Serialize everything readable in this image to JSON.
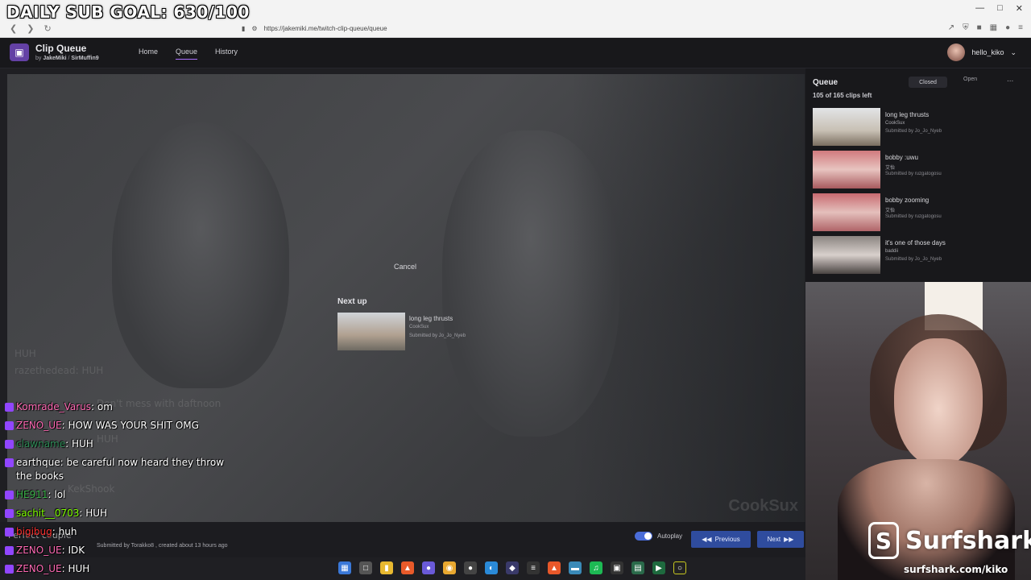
{
  "overlay": {
    "sub_goal": "DAILY SUB GOAL: 630/100"
  },
  "browser": {
    "url": "https://jakemiki.me/twitch-clip-queue/queue"
  },
  "header": {
    "title": "Clip Queue",
    "by_prefix": "by",
    "author1": "JakeMiki",
    "author_sep": "/",
    "author2": "SirMuffin9",
    "nav": [
      "Home",
      "Queue",
      "History"
    ],
    "username": "hello_kiko"
  },
  "player": {
    "cancel": "Cancel",
    "next_up_label": "Next up",
    "next_up_title": "long leg thrusts",
    "next_up_channel": "CookSux",
    "next_up_submitted": "Submitted by Jo_Jo_Nyeb",
    "watermark": "CookSux"
  },
  "bottom": {
    "created": "Submitted by Torakko8 , created about 13 hours ago",
    "autoplay": "Autoplay",
    "previous": "Previous",
    "next": "Next"
  },
  "queue": {
    "title": "Queue",
    "count": "105 of 165 clips left",
    "closed": "Closed",
    "open": "Open",
    "more": "...",
    "items": [
      {
        "title": "long leg thrusts",
        "channel": "CookSux",
        "submitted": "Submitted by Jo_Jo_Nyeb",
        "thumb_color": "#c8c0b4"
      },
      {
        "title": "bobby :uwu",
        "channel": "艾怡",
        "submitted": "Submitted by ruzgatogosu",
        "thumb_color": "#c86a6e"
      },
      {
        "title": "bobby zooming",
        "channel": "艾怡",
        "submitted": "Submitted by ruzgatogosu",
        "thumb_color": "#c87270"
      },
      {
        "title": "it's one of those days",
        "channel": "baddii",
        "submitted": "Submitted by Jo_Jo_Nyeb",
        "thumb_color": "#6a6462"
      }
    ]
  },
  "sponsor": {
    "name": "Surfshark",
    "reg": "®",
    "url": "surfshark.com/kiko"
  },
  "chat": [
    {
      "name": "Komrade_Varus",
      "message": "om",
      "color": "#ff69b4"
    },
    {
      "name": "ZENO_UE",
      "message": "HOW WAS YOUR SHIT OMG",
      "color": "#ff69b4"
    },
    {
      "name": "clawname",
      "message": "HUH",
      "color": "#2e8b57"
    },
    {
      "name": "earthque",
      "message": "be careful now heard they throw the books",
      "color": "#ffffff"
    },
    {
      "name": "HE911",
      "message": "lol",
      "color": "#3cb44b"
    },
    {
      "name": "sachit__0703",
      "message": "HUH",
      "color": "#7fff00"
    },
    {
      "name": "bigibug",
      "message": "huh",
      "color": "#ff3030"
    },
    {
      "name": "ZENO_UE",
      "message": "IDK",
      "color": "#ff69b4"
    },
    {
      "name": "ZENO_UE",
      "message": "HUH",
      "color": "#ff69b4"
    }
  ],
  "chat_ghost": [
    "HUH",
    "razethedead: HUH",
    "Don't mess with daftnoon",
    "HUH",
    "KekShook",
    "Perfect couple"
  ]
}
